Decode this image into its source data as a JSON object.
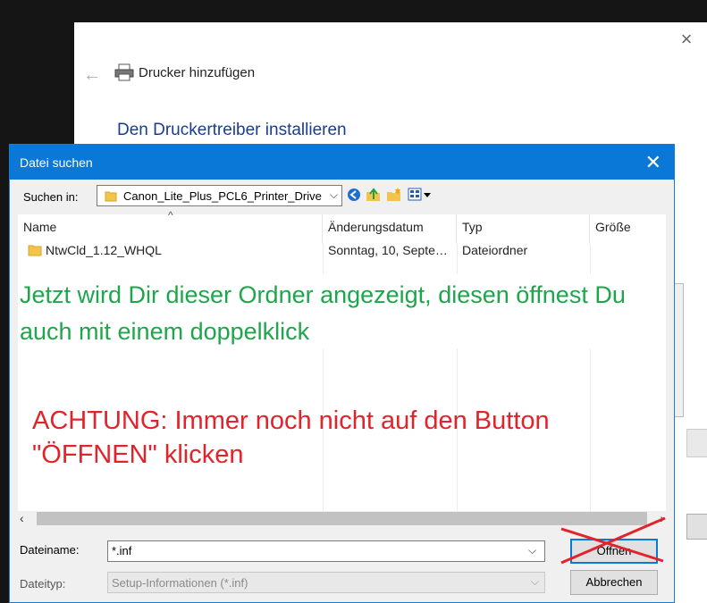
{
  "wizard": {
    "title": "Drucker hinzufügen",
    "heading": "Den Druckertreiber installieren",
    "close_symbol": "×",
    "back_symbol": "←"
  },
  "dialog": {
    "title": "Datei suchen",
    "close_symbol": "✕",
    "look_in_label": "Suchen in:",
    "look_in_value": "Canon_Lite_Plus_PCL6_Printer_Drive",
    "columns": [
      "Name",
      "Änderungsdatum",
      "Typ",
      "Größe"
    ],
    "rows": [
      {
        "name": "NtwCld_1.12_WHQL",
        "date": "Sonntag, 10, Septe…",
        "type": "Dateiordner",
        "size": ""
      }
    ],
    "filename_label": "Dateiname:",
    "filename_value": "*.inf",
    "filetype_label": "Dateityp:",
    "filetype_value": "Setup-Informationen (*.inf)",
    "open_label": "Öffnen",
    "cancel_label": "Abbrechen"
  },
  "annotations": {
    "green_text": "Jetzt wird Dir dieser Ordner angezeigt, diesen öffnest Du auch mit einem doppelklick",
    "red_text": "ACHTUNG: Immer noch nicht auf den Button \"ÖFFNEN\" klicken",
    "green_color": "#1ea64b",
    "red_color": "#e0242c"
  },
  "icons": [
    "printer-icon",
    "folder-icon",
    "back-nav-icon",
    "up-folder-icon",
    "new-folder-icon",
    "view-menu-icon",
    "close-icon"
  ]
}
